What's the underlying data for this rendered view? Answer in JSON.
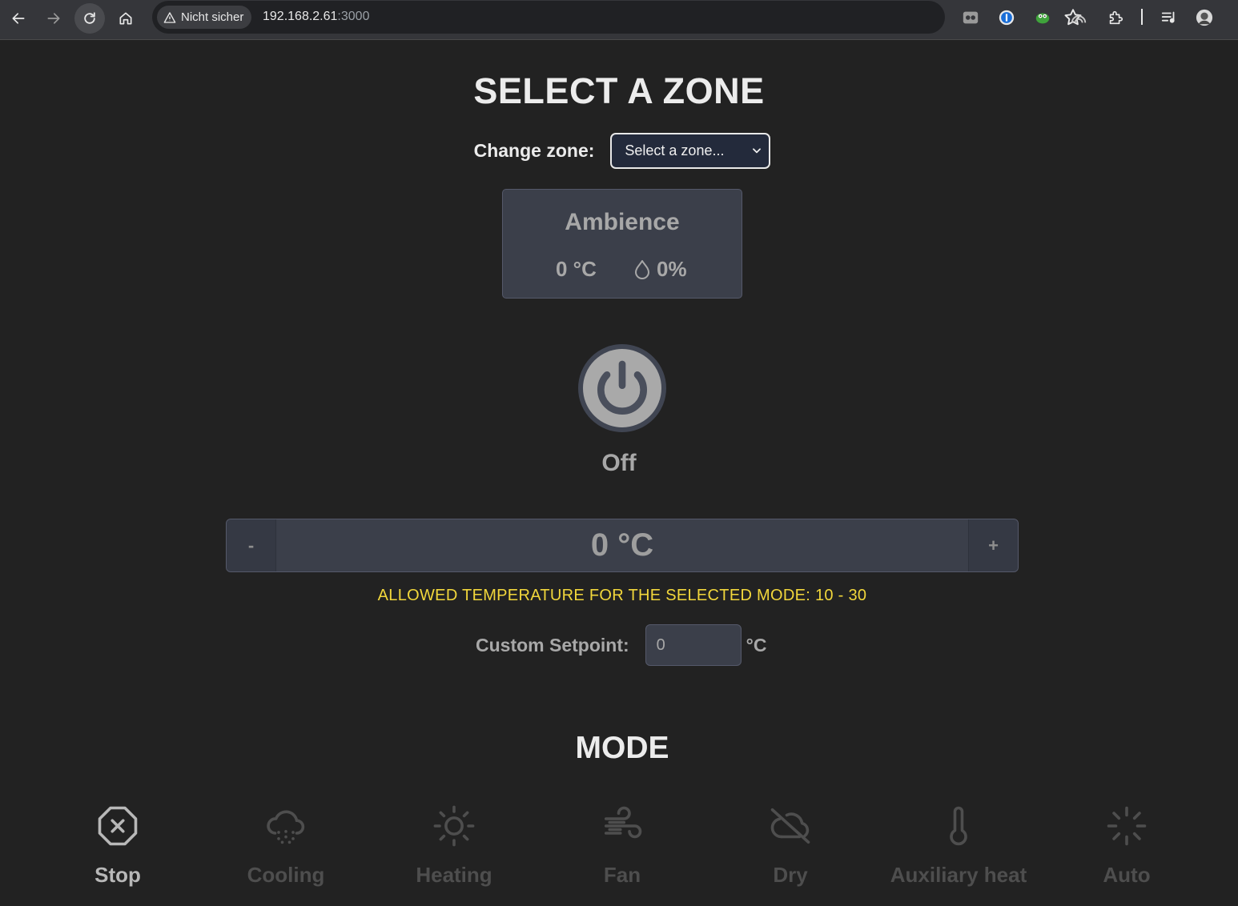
{
  "browser": {
    "security_label": "Nicht sicher",
    "url_host": "192.168.2.61",
    "url_port": ":3000"
  },
  "page": {
    "title": "SELECT A ZONE",
    "zone_label": "Change zone:",
    "zone_select_value": "Select a zone..."
  },
  "ambience": {
    "title": "Ambience",
    "temperature": "0 °C",
    "humidity": "0%"
  },
  "power": {
    "state_label": "Off"
  },
  "temperature_control": {
    "minus_label": "-",
    "plus_label": "+",
    "value": "0 °C"
  },
  "allowed_message": "ALLOWED TEMPERATURE FOR THE SELECTED MODE: 10 - 30",
  "setpoint": {
    "label": "Custom Setpoint:",
    "value": "0",
    "unit": "°C"
  },
  "mode": {
    "title": "MODE",
    "items": [
      {
        "label": "Stop",
        "icon": "stop-icon",
        "active": true
      },
      {
        "label": "Cooling",
        "icon": "snow-cloud-icon",
        "active": false
      },
      {
        "label": "Heating",
        "icon": "sun-icon",
        "active": false
      },
      {
        "label": "Fan",
        "icon": "wind-icon",
        "active": false
      },
      {
        "label": "Dry",
        "icon": "cloud-off-icon",
        "active": false
      },
      {
        "label": "Auxiliary heat",
        "icon": "thermometer-icon",
        "active": false
      },
      {
        "label": "Auto",
        "icon": "loader-icon",
        "active": false
      }
    ]
  },
  "colors": {
    "background": "#222222",
    "card": "#3b3f4a",
    "warning_text": "#f2d73b",
    "inactive_mode": "#4e4e4e"
  }
}
